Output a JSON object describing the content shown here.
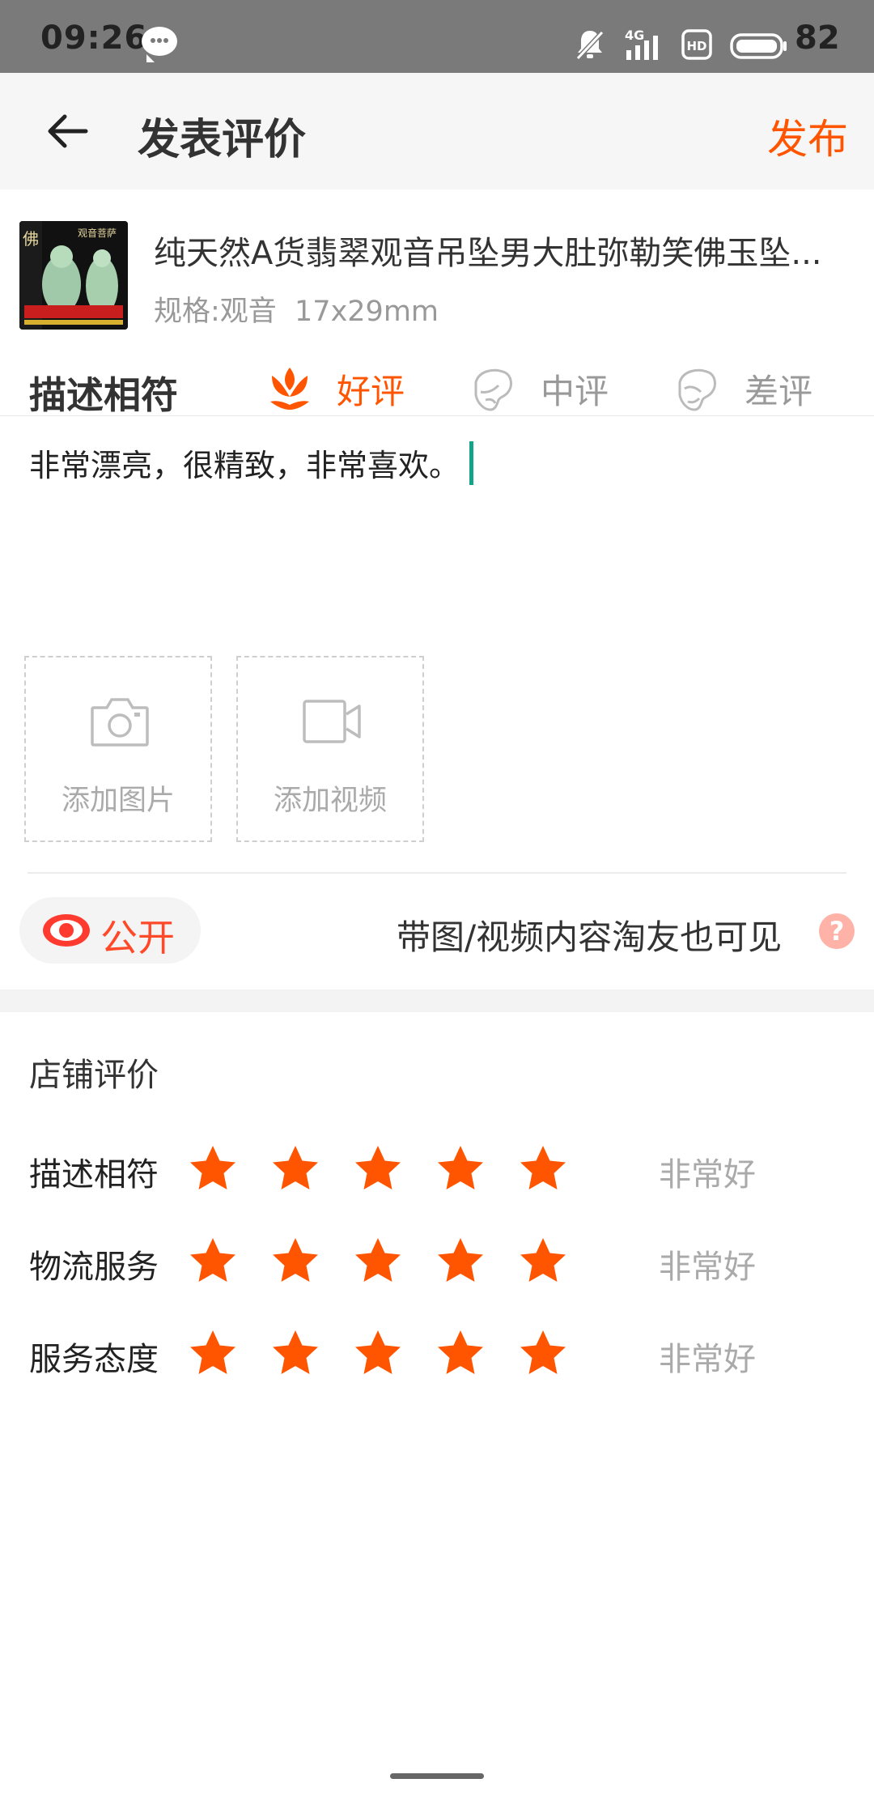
{
  "status_bar": {
    "time": "09:26",
    "network": "4G",
    "battery": "82",
    "icons": [
      "chat-bubble-icon",
      "mute-icon",
      "signal-icon",
      "hd-icon",
      "battery-icon"
    ]
  },
  "header": {
    "title": "发表评价",
    "publish": "发布",
    "back_icon": "back-arrow-icon"
  },
  "product": {
    "title": "纯天然A货翡翠观音吊坠男大肚弥勒笑佛玉坠...",
    "spec": "规格:观音  17x29mm",
    "thumb_text_left": "佛",
    "thumb_text_right": "观音菩萨"
  },
  "rating": {
    "label": "描述相符",
    "options": [
      {
        "label": "好评",
        "icon": "flower-good-icon",
        "selected": true
      },
      {
        "label": "中评",
        "icon": "face-mid-icon",
        "selected": false
      },
      {
        "label": "差评",
        "icon": "face-bad-icon",
        "selected": false
      }
    ]
  },
  "review": {
    "text": "非常漂亮，很精致，非常喜欢。"
  },
  "uploads": {
    "image": "添加图片",
    "video": "添加视频",
    "image_icon": "camera-icon",
    "video_icon": "video-camera-icon"
  },
  "visibility": {
    "toggle": "公开",
    "note": "带图/视频内容淘友也可见",
    "help": "?"
  },
  "shop": {
    "title": "店铺评价",
    "rows": [
      {
        "label": "描述相符",
        "stars": 5,
        "text": "非常好"
      },
      {
        "label": "物流服务",
        "stars": 5,
        "text": "非常好"
      },
      {
        "label": "服务态度",
        "stars": 5,
        "text": "非常好"
      }
    ]
  },
  "colors": {
    "accent": "#ff5500",
    "caret": "#12a38a",
    "status_bar": "#7a7a7a"
  }
}
